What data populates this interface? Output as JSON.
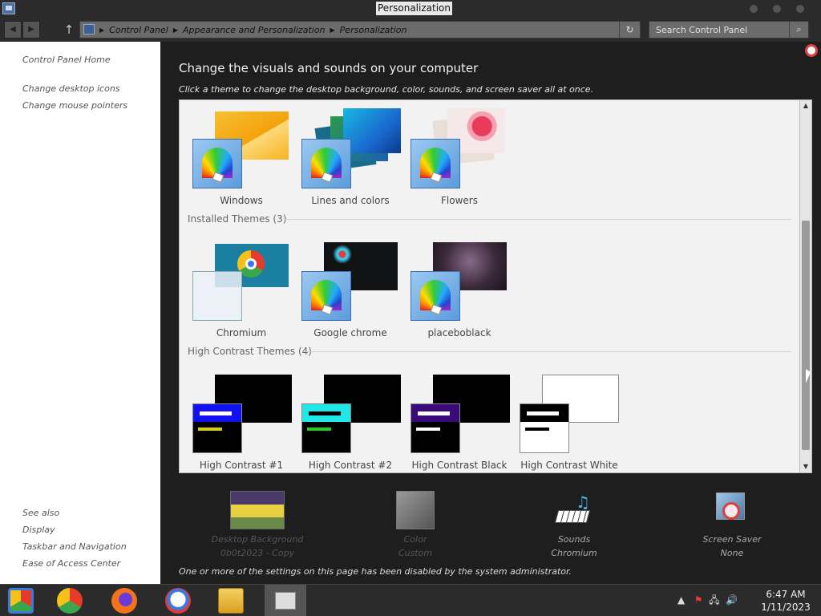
{
  "window": {
    "title": "Personalization"
  },
  "address": {
    "crumbs": [
      "Control Panel",
      "Appearance and Personalization",
      "Personalization"
    ],
    "search_placeholder": "Search Control Panel"
  },
  "left_pane": {
    "home": "Control Panel Home",
    "links": [
      "Change desktop icons",
      "Change mouse pointers"
    ],
    "see_also_title": "See also",
    "see_also": [
      "Display",
      "Taskbar and Navigation",
      "Ease of Access Center"
    ]
  },
  "main": {
    "heading": "Change the visuals and sounds on your computer",
    "subtitle": "Click a theme to change the desktop background, color, sounds, and screen saver all at once.",
    "default_themes": [
      "Windows",
      "Lines and colors",
      "Flowers"
    ],
    "installed_header": "Installed Themes (3)",
    "installed_themes": [
      "Chromium",
      "Google chrome",
      "placeboblack"
    ],
    "hc_header": "High Contrast Themes (4)",
    "hc_themes": [
      "High Contrast #1",
      "High Contrast #2",
      "High Contrast Black",
      "High Contrast White"
    ],
    "tiles": {
      "background": {
        "label": "Desktop Background",
        "value": "0b0t2023 - Copy"
      },
      "color": {
        "label": "Color",
        "value": "Custom"
      },
      "sounds": {
        "label": "Sounds",
        "value": "Chromium"
      },
      "screensaver": {
        "label": "Screen Saver",
        "value": "None"
      }
    },
    "admin_note": "One or more of the settings on this page has been disabled by the system administrator."
  },
  "taskbar": {
    "time": "6:47 AM",
    "date": "1/11/2023"
  },
  "colors": {
    "accent": "#3b6fb6",
    "dark_bg": "#1e1e1e"
  }
}
